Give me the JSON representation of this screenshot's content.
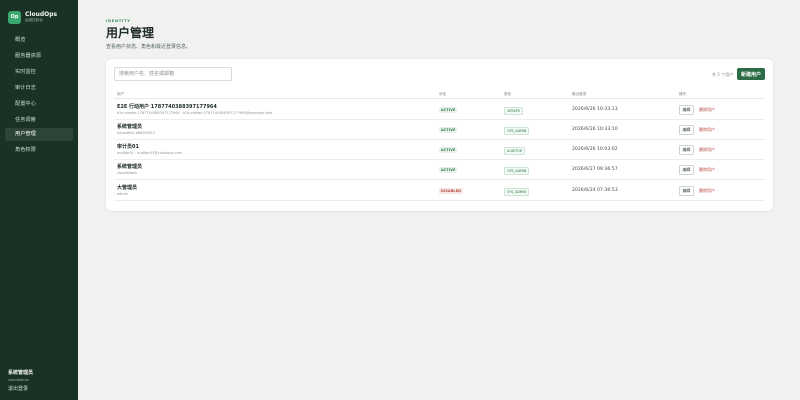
{
  "sidebar": {
    "brand_logo": "Op",
    "brand_name": "CloudOps",
    "brand_sub": "运维控制台",
    "items": [
      {
        "label": "概览"
      },
      {
        "label": "服务器资源"
      },
      {
        "label": "实时监控"
      },
      {
        "label": "审计日志"
      },
      {
        "label": "配置中心"
      },
      {
        "label": "任务调度"
      },
      {
        "label": "用户管理",
        "active": true
      },
      {
        "label": "角色权限"
      }
    ],
    "user_name": "系统管理员",
    "user_sub": "cloudadmin",
    "logout_label": "退出登录"
  },
  "header": {
    "eyebrow": "IDENTITY",
    "title": "用户管理",
    "subtitle": "查看用户状态、角色和最近登录信息。"
  },
  "toolbar": {
    "search_placeholder": "搜索用户名、姓名或邮箱",
    "count_text": "共 5 个用户",
    "new_user_label": "新建用户"
  },
  "table": {
    "columns": [
      "用户",
      "状态",
      "角色",
      "最近登录",
      "操作"
    ],
    "edit_label": "编辑",
    "delete_label": "删除用户",
    "rows": [
      {
        "name": "E2E 行动用户 1787740388397177964",
        "sub": "e2e-viewer-1787740388397177964 · e2e-viewer-1787740388397177964@example.test",
        "status": "ACTIVE",
        "role": "VIEWER",
        "last_login": "2026/6/26 10:33:13"
      },
      {
        "name": "系统管理员",
        "sub": "e2eadmin-e8d9f1053",
        "status": "ACTIVE",
        "role": "OPS_ADMIN",
        "last_login": "2026/6/26 10:33:10"
      },
      {
        "name": "审计员01",
        "sub": "auditor01 · auditor01@cloudops.com",
        "status": "ACTIVE",
        "role": "AUDITOR",
        "last_login": "2026/6/26 10:03:02"
      },
      {
        "name": "系统管理员",
        "sub": "cloudadmin",
        "status": "ACTIVE",
        "role": "OPS_ADMIN",
        "last_login": "2026/6/27 09:36:57"
      },
      {
        "name": "大管理员",
        "sub": "admin",
        "status": "DISABLED",
        "role": "SYS_ADMIN",
        "last_login": "2026/6/24 07:36:53"
      }
    ]
  },
  "colors": {
    "sidebar_bg": "#1a3126",
    "accent": "#2b6b45",
    "active_status": "#2d7a4a",
    "disabled_status": "#b3443a"
  }
}
